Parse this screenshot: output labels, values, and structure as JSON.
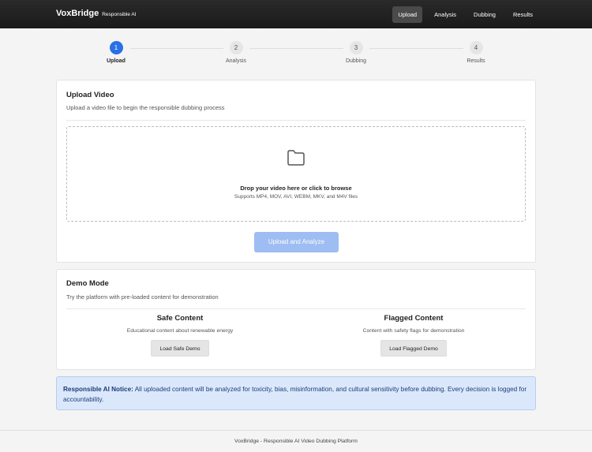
{
  "header": {
    "brand": "VoxBridge",
    "tagline": "Responsible AI",
    "nav": [
      {
        "label": "Upload",
        "active": true
      },
      {
        "label": "Analysis",
        "active": false
      },
      {
        "label": "Dubbing",
        "active": false
      },
      {
        "label": "Results",
        "active": false
      }
    ]
  },
  "stepper": {
    "steps": [
      {
        "number": "1",
        "label": "Upload",
        "active": true
      },
      {
        "number": "2",
        "label": "Analysis",
        "active": false
      },
      {
        "number": "3",
        "label": "Dubbing",
        "active": false
      },
      {
        "number": "4",
        "label": "Results",
        "active": false
      }
    ]
  },
  "upload": {
    "title": "Upload Video",
    "subtitle": "Upload a video file to begin the responsible dubbing process",
    "drop_icon": "folder-icon",
    "drop_title": "Drop your video here or click to browse",
    "drop_sub": "Supports MP4, MOV, AVI, WEBM, MKV, and M4V files",
    "button": "Upload and Analyze"
  },
  "demo": {
    "title": "Demo Mode",
    "subtitle": "Try the platform with pre-loaded content for demonstration",
    "safe": {
      "title": "Safe Content",
      "desc": "Educational content about renewable energy",
      "button": "Load Safe Demo"
    },
    "flagged": {
      "title": "Flagged Content",
      "desc": "Content with safety flags for demonstration",
      "button": "Load Flagged Demo"
    }
  },
  "notice": {
    "label": "Responsible AI Notice:",
    "text": "All uploaded content will be analyzed for toxicity, bias, misinformation, and cultural sensitivity before dubbing. Every decision is logged for accountability."
  },
  "footer": {
    "text": "VoxBridge - Responsible AI Video Dubbing Platform"
  },
  "colors": {
    "accent": "#2a6fe6",
    "button_disabled": "#9ebdf2",
    "notice_bg": "#dbe8fb",
    "header_bg": "#1f1f1f"
  }
}
